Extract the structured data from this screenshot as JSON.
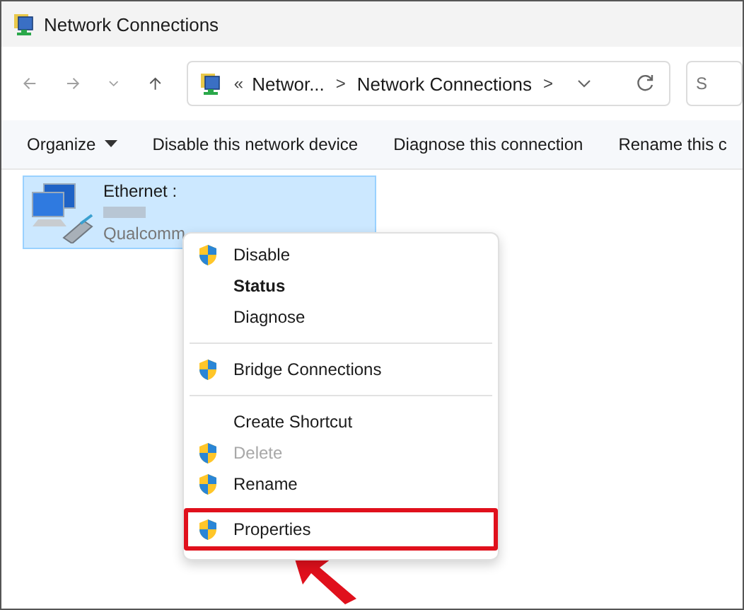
{
  "window": {
    "title": "Network Connections"
  },
  "address_bar": {
    "crumbs": [
      {
        "text": "«",
        "kind": "chevrons"
      },
      {
        "text": "Networ...",
        "kind": "crumb"
      },
      {
        "text": ">",
        "kind": "separator"
      },
      {
        "text": "Network Connections",
        "kind": "crumb"
      },
      {
        "text": ">",
        "kind": "separator"
      }
    ]
  },
  "search": {
    "placeholder": "S"
  },
  "command_bar": [
    {
      "label": "Organize",
      "dropdown": true
    },
    {
      "label": "Disable this network device",
      "dropdown": false
    },
    {
      "label": "Diagnose this connection",
      "dropdown": false
    },
    {
      "label": "Rename this c",
      "dropdown": false
    }
  ],
  "connections": [
    {
      "name": "Ethernet :",
      "device": "Qualcomm",
      "selected": true
    }
  ],
  "context_menu": [
    {
      "kind": "item",
      "label": "Disable",
      "shield": true,
      "bold": false,
      "disabled": false,
      "highlighted": false
    },
    {
      "kind": "item",
      "label": "Status",
      "shield": false,
      "bold": true,
      "disabled": false,
      "highlighted": false
    },
    {
      "kind": "item",
      "label": "Diagnose",
      "shield": false,
      "bold": false,
      "disabled": false,
      "highlighted": false
    },
    {
      "kind": "separator"
    },
    {
      "kind": "item",
      "label": "Bridge Connections",
      "shield": true,
      "bold": false,
      "disabled": false,
      "highlighted": false
    },
    {
      "kind": "separator"
    },
    {
      "kind": "item",
      "label": "Create Shortcut",
      "shield": false,
      "bold": false,
      "disabled": false,
      "highlighted": false
    },
    {
      "kind": "item",
      "label": "Delete",
      "shield": true,
      "bold": false,
      "disabled": true,
      "highlighted": false
    },
    {
      "kind": "item",
      "label": "Rename",
      "shield": true,
      "bold": false,
      "disabled": false,
      "highlighted": false
    },
    {
      "kind": "item",
      "label": "Properties",
      "shield": true,
      "bold": false,
      "disabled": false,
      "highlighted": true
    }
  ]
}
